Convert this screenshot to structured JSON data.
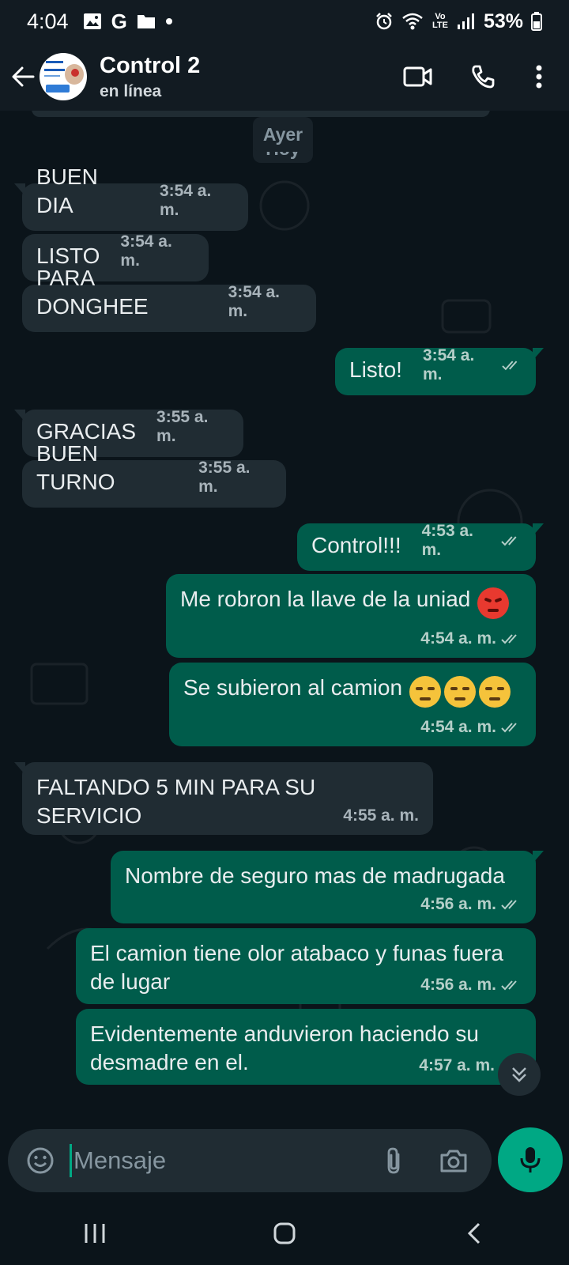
{
  "status_bar": {
    "time": "4:04",
    "left_icons": [
      "image-icon",
      "google-icon",
      "folder-icon",
      "dot-icon"
    ],
    "right_icons": [
      "alarm-icon",
      "wifi-icon",
      "volte-icon",
      "signal-icon",
      "battery-icon"
    ],
    "volte_label": "Vo LTE",
    "battery": "53%"
  },
  "header": {
    "contact_name": "Control 2",
    "status": "en línea",
    "actions": [
      "video-call-icon",
      "voice-call-icon",
      "more-options-icon"
    ]
  },
  "chat": {
    "date_chips": [
      "Ayer",
      "Hoy"
    ],
    "messages": [
      {
        "dir": "in",
        "text": "BUEN DIA",
        "time": "3:54 a. m."
      },
      {
        "dir": "in",
        "text": "LISTO",
        "time": "3:54 a. m."
      },
      {
        "dir": "in",
        "text": "PARA DONGHEE",
        "time": "3:54 a. m."
      },
      {
        "dir": "out",
        "text": "Listo!",
        "time": "3:54 a. m."
      },
      {
        "dir": "in",
        "text": "GRACIAS",
        "time": "3:55 a. m."
      },
      {
        "dir": "in",
        "text": "BUEN TURNO",
        "time": "3:55 a. m."
      },
      {
        "dir": "out",
        "text": "Control!!!",
        "time": "4:53 a. m."
      },
      {
        "dir": "out",
        "text": "Me robron la llave de la uniad",
        "time": "4:54 a. m.",
        "emoji": [
          "angry-face-emoji"
        ]
      },
      {
        "dir": "out",
        "text": "Se subieron al camion",
        "time": "4:54 a. m.",
        "emoji": [
          "unamused-face-emoji",
          "unamused-face-emoji",
          "unamused-face-emoji"
        ]
      },
      {
        "dir": "in",
        "text": "FALTANDO 5 MIN PARA SU SERVICIO",
        "time": "4:55 a. m."
      },
      {
        "dir": "out",
        "text": "Nombre de seguro mas de madrugada",
        "time": "4:56 a. m."
      },
      {
        "dir": "out",
        "text_lines": [
          "El camion tiene olor atabaco y funas fuera",
          "de lugar"
        ],
        "time": "4:56 a. m."
      },
      {
        "dir": "out",
        "text_lines": [
          "Evidentemente anduvieron haciendo su",
          "desmadre en el."
        ],
        "time": "4:57 a. m."
      }
    ]
  },
  "composer": {
    "placeholder": "Mensaje"
  },
  "colors": {
    "background": "#0b141a",
    "header": "#121b22",
    "incoming_bubble": "#202c33",
    "outgoing_bubble": "#005c4b",
    "accent": "#00a884"
  }
}
